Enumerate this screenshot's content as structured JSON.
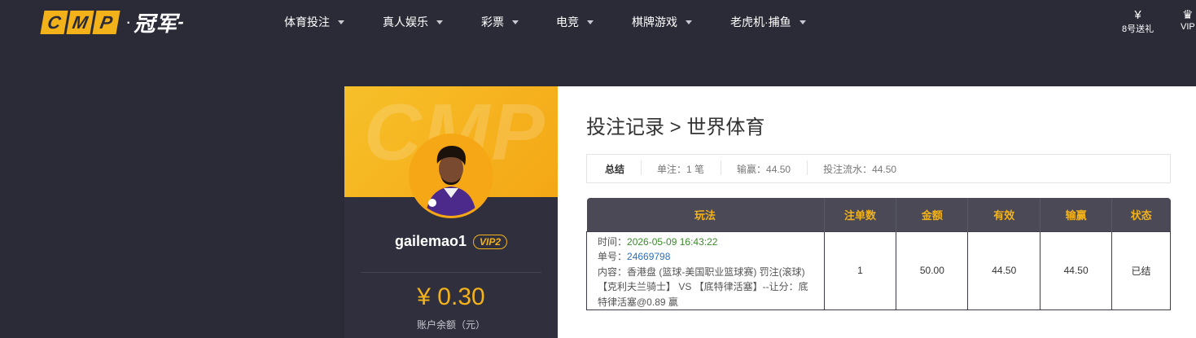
{
  "brand": {
    "logo_letters": [
      "C",
      "M",
      "P"
    ],
    "logo_dot": "·",
    "logo_cn": "冠军",
    "logo_dash": "-"
  },
  "nav": {
    "items": [
      {
        "label": "体育投注"
      },
      {
        "label": "真人娱乐"
      },
      {
        "label": "彩票"
      },
      {
        "label": "电竞"
      },
      {
        "label": "棋牌游戏"
      },
      {
        "label": "老虎机·捕鱼"
      }
    ],
    "right": [
      {
        "icon": "yen-gift-icon",
        "label": "8号送礼"
      },
      {
        "icon": "crown-icon",
        "label": "VIP"
      }
    ]
  },
  "profile": {
    "banner_watermark": "CMP",
    "username": "gailemao1",
    "vip": "VIP2",
    "balance": "¥ 0.30",
    "balance_label": "账户余额（元）"
  },
  "main": {
    "title": "投注记录 > 世界体育",
    "summary": {
      "title": "总结",
      "single": "单注：1 笔",
      "win_loss": "输赢：44.50",
      "turnover": "投注流水：44.50"
    },
    "table": {
      "headers": [
        "玩法",
        "注单数",
        "金额",
        "有效",
        "输赢",
        "状态"
      ],
      "rows": [
        {
          "time_label": "时间：",
          "time": "2026-05-09 16:43:22",
          "order_label": "单号：",
          "order": "24669798",
          "content": "内容：香港盘 (篮球-美国职业篮球赛) 罚注(滚球) 【克利夫兰骑士】 VS 【底特律活塞】--让分：底特律活塞@0.89 赢",
          "count": "1",
          "amount": "50.00",
          "valid": "44.50",
          "win_loss": "44.50",
          "status": "已结"
        }
      ]
    }
  },
  "colors": {
    "accent": "#f3b219",
    "bg_dark": "#2b2b38",
    "panel": "#2f2f3d",
    "header": "#4a4955",
    "positive": "#3a8a2a",
    "link": "#2a6fb8"
  }
}
